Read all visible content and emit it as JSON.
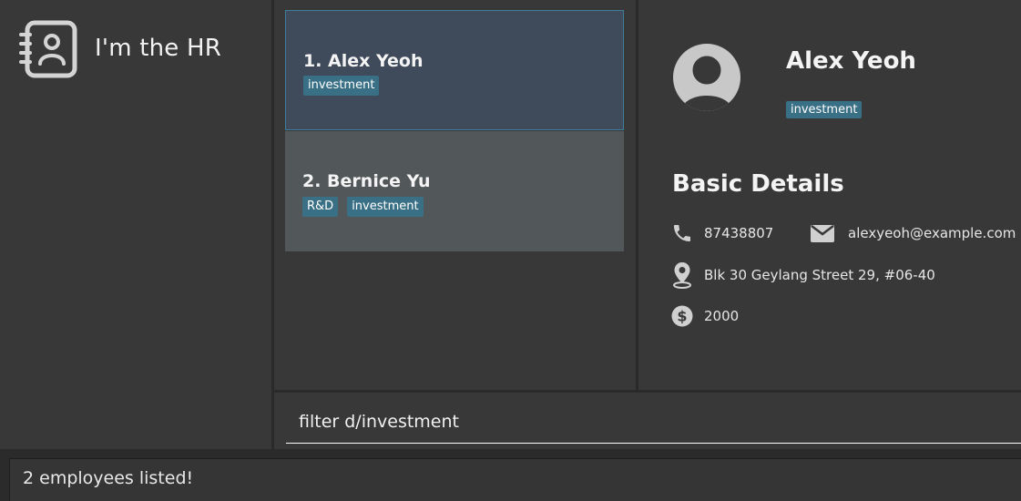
{
  "app": {
    "title": "I'm the HR",
    "logo_icon": "contact-book-icon"
  },
  "employee_list": {
    "items": [
      {
        "index": "1.",
        "name": "Alex Yeoh",
        "display": "1.  Alex Yeoh",
        "tags": [
          "investment"
        ],
        "selected": true
      },
      {
        "index": "2.",
        "name": "Bernice Yu",
        "display": "2.  Bernice Yu",
        "tags": [
          "R&D",
          "investment"
        ],
        "selected": false
      }
    ]
  },
  "detail": {
    "name": "Alex Yeoh",
    "tags": [
      "investment"
    ],
    "section_title": "Basic Details",
    "phone": "87438807",
    "email": "alexyeoh@example.com",
    "address": "Blk 30 Geylang Street 29, #06-40",
    "salary": "2000",
    "icons": {
      "avatar": "user-avatar-icon",
      "phone": "phone-icon",
      "email": "envelope-icon",
      "address": "location-pin-icon",
      "salary": "dollar-icon"
    }
  },
  "command": {
    "value": "filter d/investment"
  },
  "result": {
    "message": "2 employees listed!"
  },
  "colors": {
    "background": "#2b2b2b",
    "panel": "#383838",
    "selected_card": "#3f4a5a",
    "selected_border": "#3e7d9b",
    "card_alt": "#525759",
    "tag": "#3a7085"
  }
}
